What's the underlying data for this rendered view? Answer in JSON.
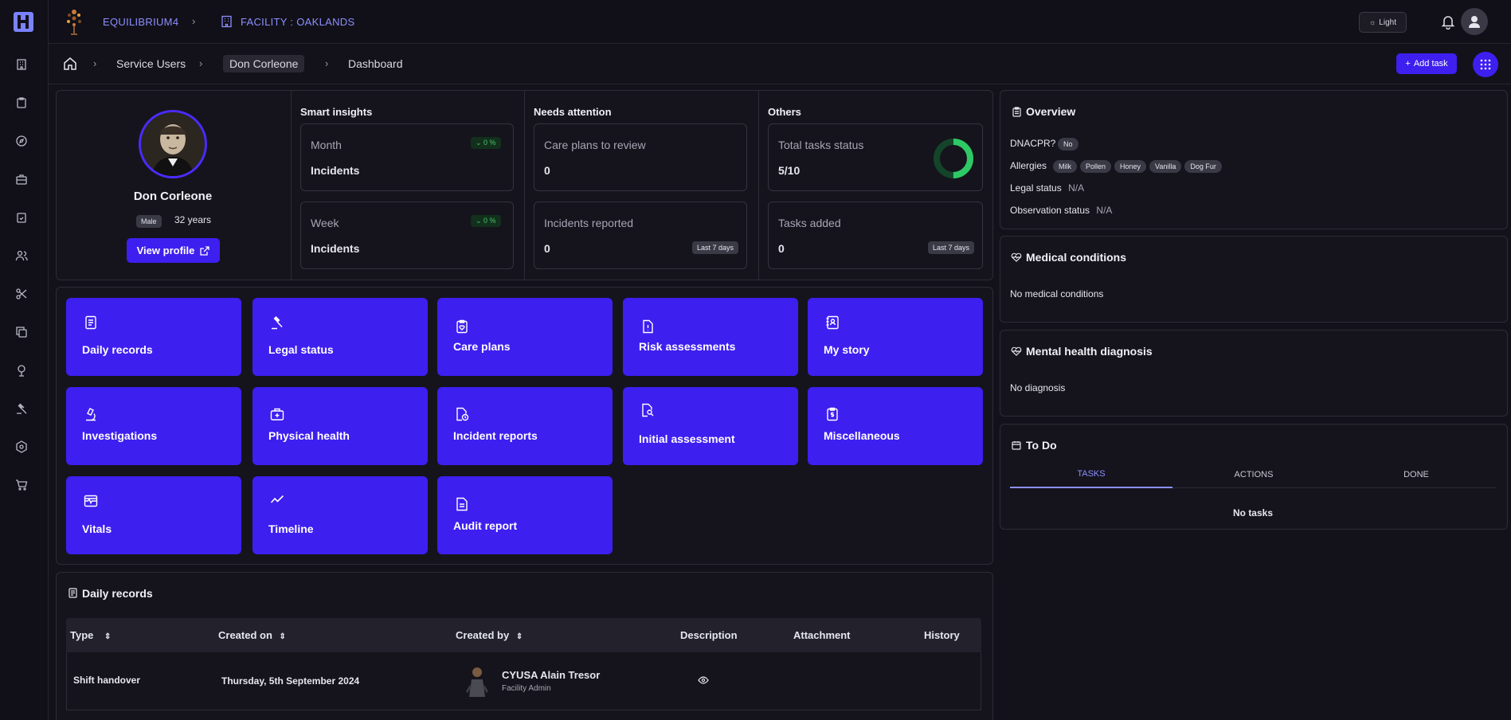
{
  "topbar": {
    "org_name": "EQUILIBRIUM4",
    "facility_label": "FACILITY :  OAKLANDS",
    "theme_label": "Light"
  },
  "breadcrumb": {
    "items": [
      "Service Users",
      "Don Corleone",
      "Dashboard"
    ],
    "add_task_label": "Add task"
  },
  "profile": {
    "name": "Don Corleone",
    "gender": "Male",
    "age": "32 years",
    "view_profile_label": "View profile"
  },
  "smart_insights": {
    "title": "Smart insights",
    "cards": [
      {
        "period": "Month",
        "label": "Incidents",
        "change": "0 %"
      },
      {
        "period": "Week",
        "label": "Incidents",
        "change": "0 %"
      }
    ]
  },
  "needs_attention": {
    "title": "Needs attention",
    "cards": [
      {
        "label": "Care plans to review",
        "value": "0"
      },
      {
        "label": "Incidents reported",
        "value": "0",
        "badge": "Last 7 days"
      }
    ]
  },
  "others": {
    "title": "Others",
    "cards": [
      {
        "label": "Total tasks status",
        "value": "5/10"
      },
      {
        "label": "Tasks added",
        "value": "0",
        "badge": "Last 7 days"
      }
    ],
    "task_completion_fraction": 0.5
  },
  "tiles": [
    {
      "label": "Daily records",
      "icon": "document-icon"
    },
    {
      "label": "Legal status",
      "icon": "gavel-icon"
    },
    {
      "label": "Care plans",
      "icon": "clipboard-heart-icon"
    },
    {
      "label": "Risk assessments",
      "icon": "file-alert-icon"
    },
    {
      "label": "My story",
      "icon": "book-user-icon"
    },
    {
      "label": "Investigations",
      "icon": "microscope-icon"
    },
    {
      "label": "Physical health",
      "icon": "medkit-icon"
    },
    {
      "label": "Incident reports",
      "icon": "file-clock-icon"
    },
    {
      "label": "Initial assessment",
      "icon": "file-search-icon"
    },
    {
      "label": "Miscellaneous",
      "icon": "clipboard-dollar-icon"
    },
    {
      "label": "Vitals",
      "icon": "monitor-vitals-icon"
    },
    {
      "label": "Timeline",
      "icon": "trend-line-icon"
    },
    {
      "label": "Audit report",
      "icon": "file-text-icon"
    }
  ],
  "daily_records": {
    "title": "Daily records",
    "columns": [
      "Type",
      "Created on",
      "Created by",
      "Description",
      "Attachment",
      "History"
    ],
    "rows": [
      {
        "type": "Shift handover",
        "created_on": "Thursday, 5th September 2024",
        "created_by": "CYUSA Alain Tresor",
        "role": "Facility Admin"
      }
    ]
  },
  "overview": {
    "title": "Overview",
    "dnacpr_label": "DNACPR?",
    "dnacpr_value": "No",
    "allergies_label": "Allergies",
    "allergies": [
      "Milk",
      "Pollen",
      "Honey",
      "Vanilla",
      "Dog Fur"
    ],
    "legal_status_label": "Legal status",
    "legal_status_value": "N/A",
    "observation_label": "Observation status",
    "observation_value": "N/A"
  },
  "medical": {
    "title": "Medical conditions",
    "empty": "No medical conditions"
  },
  "mental": {
    "title": "Mental health diagnosis",
    "empty": "No diagnosis"
  },
  "todo": {
    "title": "To Do",
    "tabs": [
      "TASKS",
      "ACTIONS",
      "DONE"
    ],
    "active_tab": "TASKS",
    "empty": "No tasks"
  },
  "colors": {
    "accent": "#3d1ff0",
    "link": "#8c8fff",
    "success": "#2ec865"
  }
}
